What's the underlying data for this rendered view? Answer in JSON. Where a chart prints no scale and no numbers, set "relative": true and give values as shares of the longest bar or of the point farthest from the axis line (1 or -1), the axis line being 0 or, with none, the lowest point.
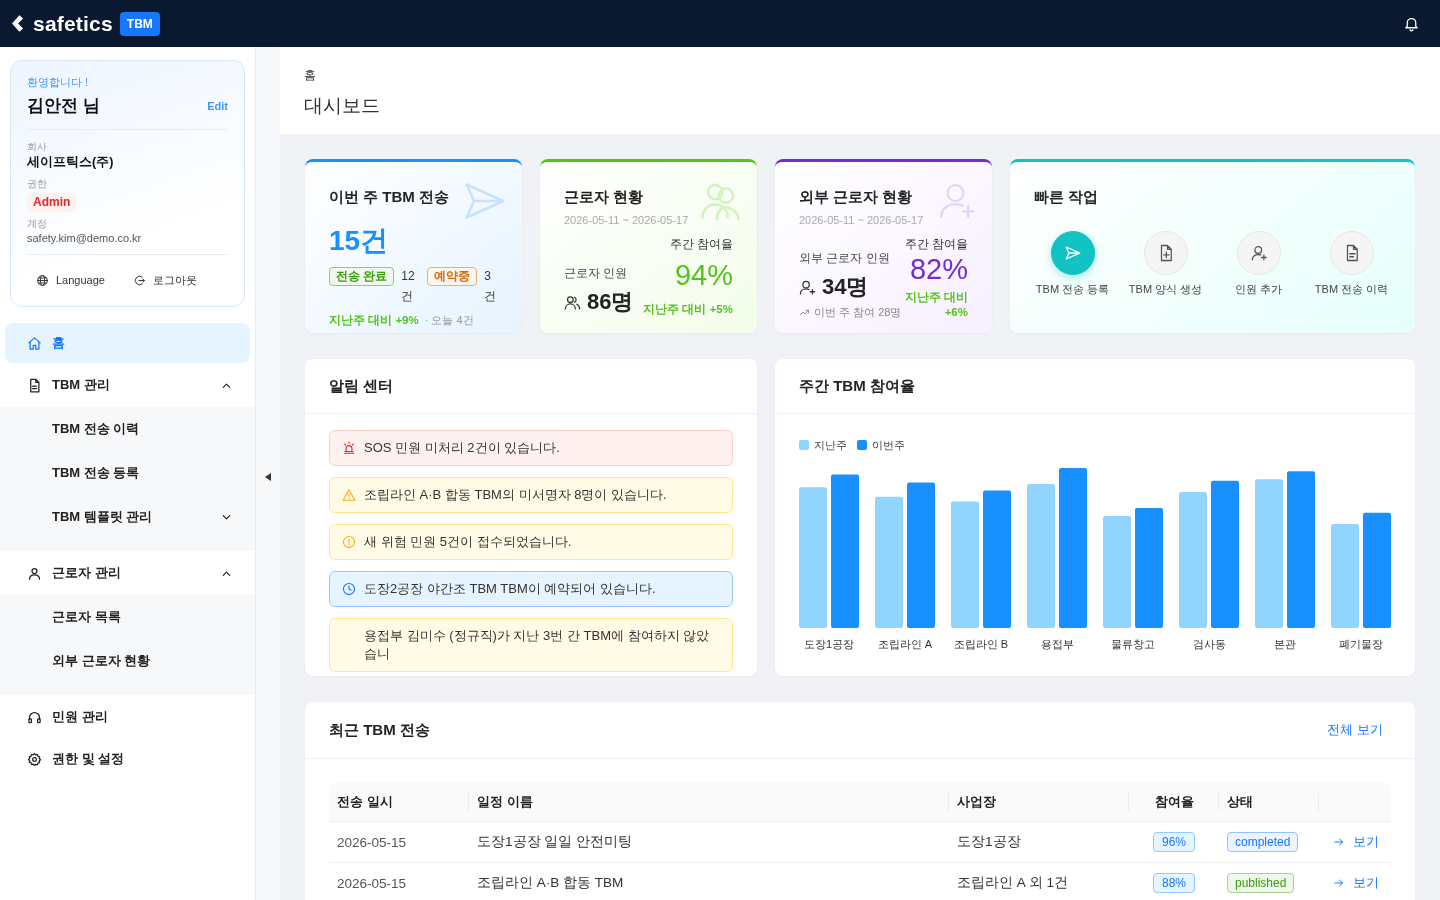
{
  "topbar": {
    "brand": "safetics",
    "badge": "TBM"
  },
  "profile": {
    "greeting": "환영합니다 !",
    "name": "김안전 님",
    "edit": "Edit",
    "fields": [
      {
        "label": "회사",
        "value": "세이프틱스(주)",
        "kind": "strong"
      },
      {
        "label": "권한",
        "value": "Admin",
        "kind": "role"
      },
      {
        "label": "계정",
        "value": "safety.kim@demo.co.kr",
        "kind": "plain"
      }
    ],
    "actions": [
      "Language",
      "로그아웃"
    ]
  },
  "nav": [
    {
      "label": "홈",
      "selected": true
    },
    {
      "label": "TBM 관리",
      "selected": false,
      "expanded": true,
      "children": [
        {
          "label": "TBM 전송 이력",
          "selected": false
        },
        {
          "label": "TBM 전송 등록",
          "selected": false
        },
        {
          "label": "TBM 템플릿 관리",
          "selected": false,
          "expanded": false
        }
      ]
    },
    {
      "label": "근로자 관리",
      "selected": false,
      "expanded": true,
      "children": [
        {
          "label": "근로자 목록",
          "selected": false
        },
        {
          "label": "외부 근로자 현황",
          "selected": false
        }
      ]
    },
    {
      "label": "민원 관리",
      "selected": false
    },
    {
      "label": "권한 및 설정",
      "selected": false
    }
  ],
  "page": {
    "breadcrumb": "홈",
    "title": "대시보드"
  },
  "stat_cards": [
    {
      "kind": "tbm",
      "title": "이번 주 TBM 전송",
      "value": "15건",
      "tags": [
        {
          "label": "전송 완료",
          "count": "12 건",
          "color": "#389e0d"
        },
        {
          "label": "예약중",
          "count": "3 건",
          "color": "#d46b08"
        }
      ],
      "change": "지난주 대비 +9%",
      "note": "· 오늘 4건"
    },
    {
      "kind": "workers",
      "title": "근로자 현황",
      "period": "2026-05-11 ~ 2026-05-17",
      "count_label": "근로자 인원",
      "count": "86명",
      "rate_label": "주간 참여율",
      "rate": "94%",
      "change": "지난주 대비 +5%"
    },
    {
      "kind": "external",
      "title": "외부 근로자 현황",
      "period": "2026-05-11 ~ 2026-05-17",
      "count_label": "외부 근로자 인원",
      "count": "34명",
      "note": "이번 주 참여 28명",
      "rate_label": "주간 참여율",
      "rate": "82%",
      "change": "지난주 대비 +6%"
    }
  ],
  "quick_actions": {
    "title": "빠른 작업",
    "items": [
      {
        "label": "TBM 전송 등록",
        "primary": true
      },
      {
        "label": "TBM 양식 생성",
        "primary": false
      },
      {
        "label": "인원 추가",
        "primary": false
      },
      {
        "label": "TBM 전송 이력",
        "primary": false
      }
    ]
  },
  "alerts": {
    "title": "알림 센터",
    "items": [
      {
        "kind": "sos",
        "text": "SOS 민원 미처리 2건이 있습니다."
      },
      {
        "kind": "warning",
        "text": "조립라인 A·B 합동 TBM의 미서명자 8명이 있습니다."
      },
      {
        "kind": "notice",
        "text": "새 위험 민원 5건이 접수되었습니다."
      },
      {
        "kind": "schedule",
        "text": "도장2공장 야간조 TBM TBM이 예약되어 있습니다."
      },
      {
        "kind": "absence",
        "text": "용접부 김미수 (정규직)가 지난 3번 간 TBM에 참여하지 않았습니"
      }
    ]
  },
  "chart": {
    "title": "주간 TBM 참여율",
    "chart_data": {
      "type": "bar",
      "legend": "top-left",
      "relative": true,
      "categories": [
        "도장1공장",
        "조립라인 A",
        "조립라인 B",
        "용접부",
        "물류창고",
        "검사동",
        "본관",
        "폐기물장"
      ],
      "series": [
        {
          "name": "지난주",
          "color": "#91d5ff",
          "values": [
            0.88,
            0.82,
            0.79,
            0.9,
            0.7,
            0.85,
            0.93,
            0.65
          ]
        },
        {
          "name": "이번주",
          "color": "#1890ff",
          "values": [
            0.96,
            0.91,
            0.86,
            1.0,
            0.75,
            0.92,
            0.98,
            0.72
          ]
        }
      ]
    }
  },
  "recent": {
    "title": "최근 TBM 전송",
    "link": "전체 보기",
    "columns": [
      "전송 일시",
      "일정 이름",
      "사업장",
      "참여율",
      "상태"
    ],
    "rows": [
      {
        "date": "2026-05-15",
        "name": "도장1공장 일일 안전미팅",
        "site": "도장1공장",
        "rate": "96%",
        "status": {
          "label": "completed",
          "color": "#1677ff"
        },
        "action": "보기"
      },
      {
        "date": "2026-05-15",
        "name": "조립라인 A·B 합동 TBM",
        "site": "조립라인 A 외 1건",
        "rate": "88%",
        "status": {
          "label": "published",
          "color": "#389e0d"
        },
        "action": "보기"
      }
    ]
  }
}
